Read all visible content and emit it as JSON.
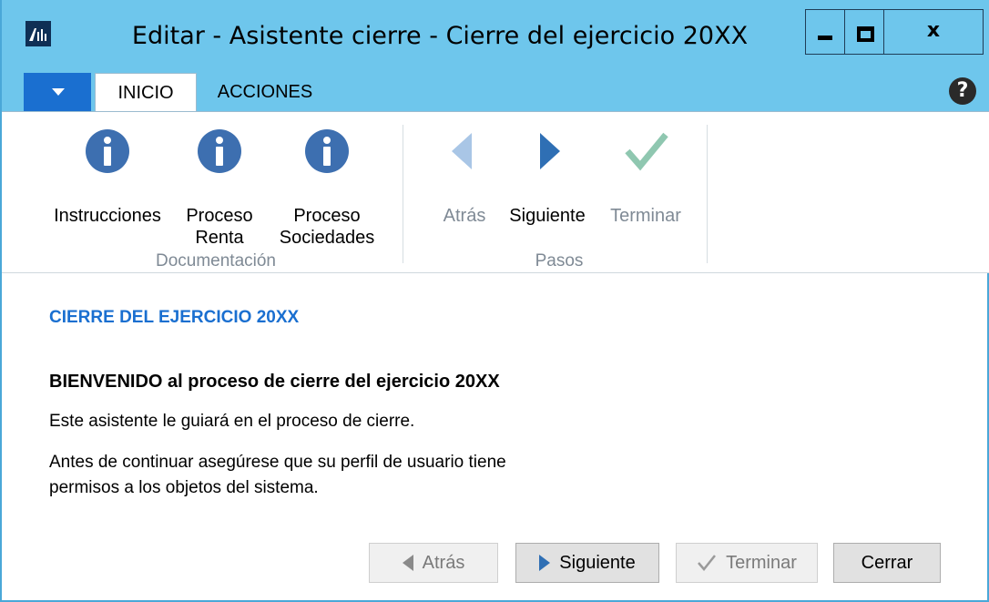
{
  "window": {
    "title": "Editar - Asistente cierre - Cierre del ejercicio 20XX",
    "close_glyph": "x",
    "icons": [
      "app-logo-icon",
      "minimize-icon",
      "maximize-icon",
      "close-icon"
    ]
  },
  "tabs": {
    "items": [
      "INICIO",
      "ACCIONES"
    ],
    "active": "INICIO",
    "help_glyph": "?"
  },
  "ribbon": {
    "documentacion": {
      "group_label": "Documentación",
      "buttons": [
        {
          "label": "Instrucciones",
          "icon": "info-icon"
        },
        {
          "label_line1": "Proceso",
          "label_line2": "Renta",
          "icon": "info-icon"
        },
        {
          "label_line1": "Proceso",
          "label_line2": "Sociedades",
          "icon": "info-icon"
        }
      ]
    },
    "pasos": {
      "group_label": "Pasos",
      "buttons": [
        {
          "label": "Atrás",
          "icon": "arrow-left-icon",
          "enabled": false
        },
        {
          "label": "Siguiente",
          "icon": "arrow-right-icon",
          "enabled": true
        },
        {
          "label": "Terminar",
          "icon": "checkmark-icon",
          "enabled": false
        }
      ]
    }
  },
  "content": {
    "heading": "CIERRE DEL EJERCICIO 20XX",
    "welcome": "BIENVENIDO al proceso de cierre del ejercicio 20XX",
    "intro": "Este asistente le guiará en el proceso de cierre.",
    "line1": "Antes de continuar asegúrese que su perfil de usuario tiene",
    "line2": "permisos a los objetos del sistema."
  },
  "footer": {
    "back": "Atrás",
    "next": "Siguiente",
    "finish": "Terminar",
    "close": "Cerrar"
  },
  "colors": {
    "titlebar": "#6ec6ec",
    "accent_blue": "#1a6fd0",
    "info_icon": "#3d6fb0",
    "disabled_arrow": "#a9c6e6",
    "disabled_check": "#8fc7b0"
  }
}
